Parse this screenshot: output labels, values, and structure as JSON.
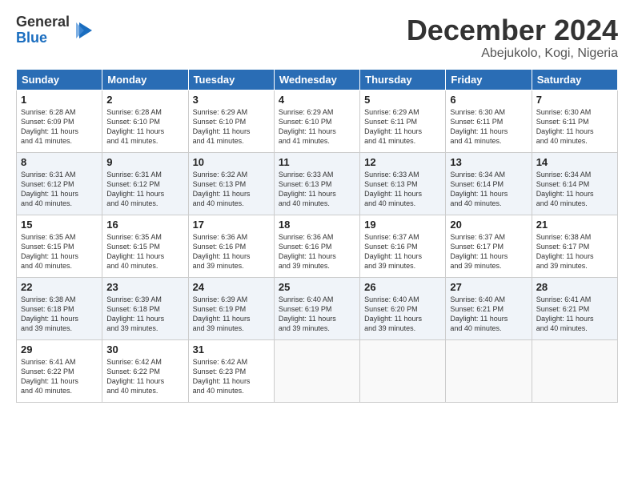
{
  "header": {
    "logo_line1": "General",
    "logo_line2": "Blue",
    "month_title": "December 2024",
    "location": "Abejukolo, Kogi, Nigeria"
  },
  "days_of_week": [
    "Sunday",
    "Monday",
    "Tuesday",
    "Wednesday",
    "Thursday",
    "Friday",
    "Saturday"
  ],
  "weeks": [
    [
      {
        "day": 1,
        "info": "Sunrise: 6:28 AM\nSunset: 6:09 PM\nDaylight: 11 hours\nand 41 minutes."
      },
      {
        "day": 2,
        "info": "Sunrise: 6:28 AM\nSunset: 6:10 PM\nDaylight: 11 hours\nand 41 minutes."
      },
      {
        "day": 3,
        "info": "Sunrise: 6:29 AM\nSunset: 6:10 PM\nDaylight: 11 hours\nand 41 minutes."
      },
      {
        "day": 4,
        "info": "Sunrise: 6:29 AM\nSunset: 6:10 PM\nDaylight: 11 hours\nand 41 minutes."
      },
      {
        "day": 5,
        "info": "Sunrise: 6:29 AM\nSunset: 6:11 PM\nDaylight: 11 hours\nand 41 minutes."
      },
      {
        "day": 6,
        "info": "Sunrise: 6:30 AM\nSunset: 6:11 PM\nDaylight: 11 hours\nand 41 minutes."
      },
      {
        "day": 7,
        "info": "Sunrise: 6:30 AM\nSunset: 6:11 PM\nDaylight: 11 hours\nand 40 minutes."
      }
    ],
    [
      {
        "day": 8,
        "info": "Sunrise: 6:31 AM\nSunset: 6:12 PM\nDaylight: 11 hours\nand 40 minutes."
      },
      {
        "day": 9,
        "info": "Sunrise: 6:31 AM\nSunset: 6:12 PM\nDaylight: 11 hours\nand 40 minutes."
      },
      {
        "day": 10,
        "info": "Sunrise: 6:32 AM\nSunset: 6:13 PM\nDaylight: 11 hours\nand 40 minutes."
      },
      {
        "day": 11,
        "info": "Sunrise: 6:33 AM\nSunset: 6:13 PM\nDaylight: 11 hours\nand 40 minutes."
      },
      {
        "day": 12,
        "info": "Sunrise: 6:33 AM\nSunset: 6:13 PM\nDaylight: 11 hours\nand 40 minutes."
      },
      {
        "day": 13,
        "info": "Sunrise: 6:34 AM\nSunset: 6:14 PM\nDaylight: 11 hours\nand 40 minutes."
      },
      {
        "day": 14,
        "info": "Sunrise: 6:34 AM\nSunset: 6:14 PM\nDaylight: 11 hours\nand 40 minutes."
      }
    ],
    [
      {
        "day": 15,
        "info": "Sunrise: 6:35 AM\nSunset: 6:15 PM\nDaylight: 11 hours\nand 40 minutes."
      },
      {
        "day": 16,
        "info": "Sunrise: 6:35 AM\nSunset: 6:15 PM\nDaylight: 11 hours\nand 40 minutes."
      },
      {
        "day": 17,
        "info": "Sunrise: 6:36 AM\nSunset: 6:16 PM\nDaylight: 11 hours\nand 39 minutes."
      },
      {
        "day": 18,
        "info": "Sunrise: 6:36 AM\nSunset: 6:16 PM\nDaylight: 11 hours\nand 39 minutes."
      },
      {
        "day": 19,
        "info": "Sunrise: 6:37 AM\nSunset: 6:16 PM\nDaylight: 11 hours\nand 39 minutes."
      },
      {
        "day": 20,
        "info": "Sunrise: 6:37 AM\nSunset: 6:17 PM\nDaylight: 11 hours\nand 39 minutes."
      },
      {
        "day": 21,
        "info": "Sunrise: 6:38 AM\nSunset: 6:17 PM\nDaylight: 11 hours\nand 39 minutes."
      }
    ],
    [
      {
        "day": 22,
        "info": "Sunrise: 6:38 AM\nSunset: 6:18 PM\nDaylight: 11 hours\nand 39 minutes."
      },
      {
        "day": 23,
        "info": "Sunrise: 6:39 AM\nSunset: 6:18 PM\nDaylight: 11 hours\nand 39 minutes."
      },
      {
        "day": 24,
        "info": "Sunrise: 6:39 AM\nSunset: 6:19 PM\nDaylight: 11 hours\nand 39 minutes."
      },
      {
        "day": 25,
        "info": "Sunrise: 6:40 AM\nSunset: 6:19 PM\nDaylight: 11 hours\nand 39 minutes."
      },
      {
        "day": 26,
        "info": "Sunrise: 6:40 AM\nSunset: 6:20 PM\nDaylight: 11 hours\nand 39 minutes."
      },
      {
        "day": 27,
        "info": "Sunrise: 6:40 AM\nSunset: 6:21 PM\nDaylight: 11 hours\nand 40 minutes."
      },
      {
        "day": 28,
        "info": "Sunrise: 6:41 AM\nSunset: 6:21 PM\nDaylight: 11 hours\nand 40 minutes."
      }
    ],
    [
      {
        "day": 29,
        "info": "Sunrise: 6:41 AM\nSunset: 6:22 PM\nDaylight: 11 hours\nand 40 minutes."
      },
      {
        "day": 30,
        "info": "Sunrise: 6:42 AM\nSunset: 6:22 PM\nDaylight: 11 hours\nand 40 minutes."
      },
      {
        "day": 31,
        "info": "Sunrise: 6:42 AM\nSunset: 6:23 PM\nDaylight: 11 hours\nand 40 minutes."
      },
      null,
      null,
      null,
      null
    ]
  ]
}
